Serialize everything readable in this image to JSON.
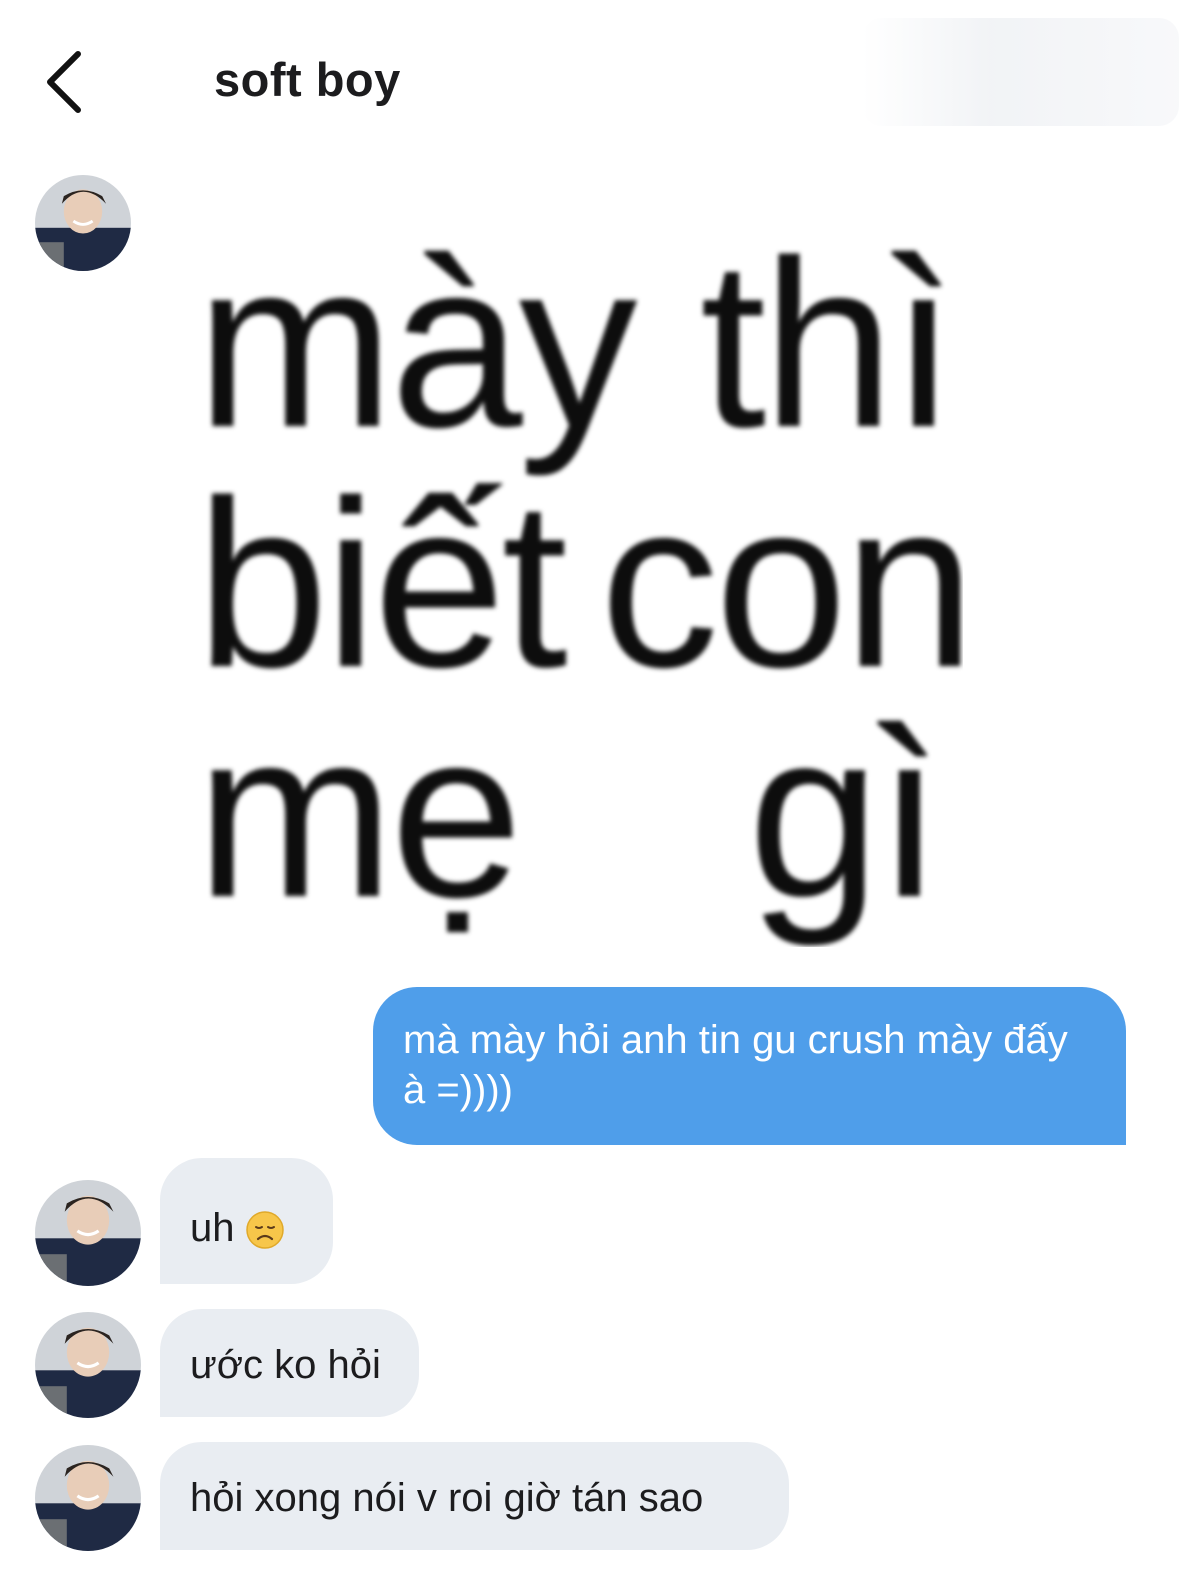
{
  "header": {
    "title": "soft boy",
    "back_icon": "chevron-left-icon"
  },
  "meme_sticker": {
    "line1": {
      "left": "mày",
      "right": "thì"
    },
    "line2": {
      "left": "biết",
      "right": "con"
    },
    "line3": {
      "left": "mẹ",
      "right": "gì"
    }
  },
  "messages": [
    {
      "from": "me",
      "text": "mà mày hỏi anh tin gu crush mày đấy à =))))"
    },
    {
      "from": "them",
      "text": "uh",
      "emoji": "disappointed-face-icon"
    },
    {
      "from": "them",
      "text": "ước ko hỏi"
    },
    {
      "from": "them",
      "text": "hỏi xong nói v roi giờ tán sao"
    }
  ],
  "colors": {
    "outgoing_bubble": "#4f9eea",
    "incoming_bubble": "#e9edf2"
  }
}
